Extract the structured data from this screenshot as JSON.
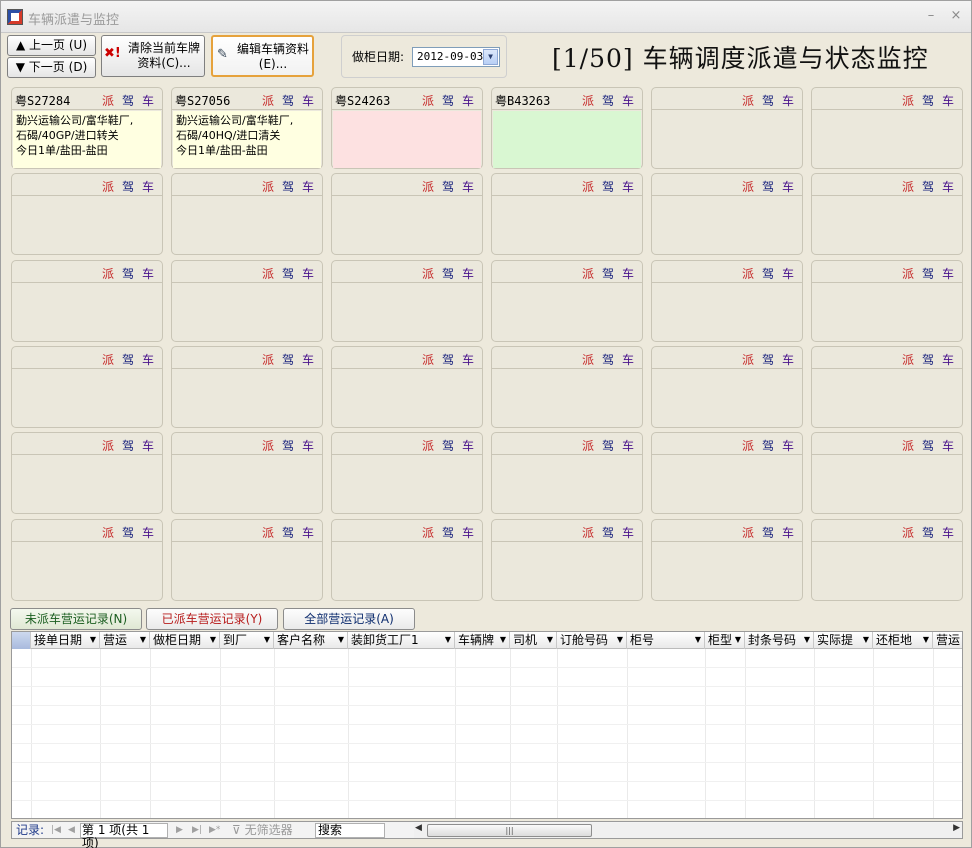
{
  "window": {
    "title": "车辆派遣与监控",
    "minimize": "–",
    "close": "×"
  },
  "toolbar": {
    "prev_label": "上一页",
    "prev_key": "(U)",
    "next_label": "下一页",
    "next_key": "(D)",
    "clear_label_1": "清除当前车牌",
    "clear_label_2": "资料(C)...",
    "edit_label_1": "编辑车辆资料",
    "edit_label_2": "(E)...",
    "date_label": "做柜日期:",
    "date_value": "2012-09-03",
    "page_title": "[1/50] 车辆调度派遣与状态监控"
  },
  "card_icons": {
    "dispatch": "派",
    "driver": "驾",
    "vehicle": "车"
  },
  "cards": [
    {
      "plate": "粤S27284",
      "lines": [
        "勤兴运输公司/富华鞋厂,",
        "石碣/40GP/进口转关",
        "今日1单/盐田-盐田"
      ],
      "state": "yellow"
    },
    {
      "plate": "粤S27056",
      "lines": [
        "勤兴运输公司/富华鞋厂,",
        "石碣/40HQ/进口清关",
        "今日1单/盐田-盐田"
      ],
      "state": "yellow"
    },
    {
      "plate": "粤S24263",
      "lines": [],
      "state": "pink"
    },
    {
      "plate": "粤B43263",
      "lines": [],
      "state": "green"
    }
  ],
  "tabs": {
    "undispatched": "未派车营运记录(N)",
    "dispatched": "已派车营运记录(Y)",
    "all": "全部营运记录(A)"
  },
  "table": {
    "columns": [
      "接单日期",
      "营运",
      "做柜日期",
      "到厂",
      "客户名称",
      "装卸货工厂1",
      "车辆牌",
      "司机",
      "订舱号码",
      "柜号",
      "柜型",
      "封条号码",
      "实际提",
      "还柜地",
      "营运"
    ]
  },
  "status": {
    "records_label": "记录:",
    "page_text": "第 1 项(共 1 项)",
    "filter_label": "无筛选器",
    "search_label": "搜索"
  },
  "colors": {
    "card_yellow": "#ffffe1",
    "card_pink": "#fde1e1",
    "card_green": "#d9f7d2",
    "accent_border": "#e6a23c"
  }
}
